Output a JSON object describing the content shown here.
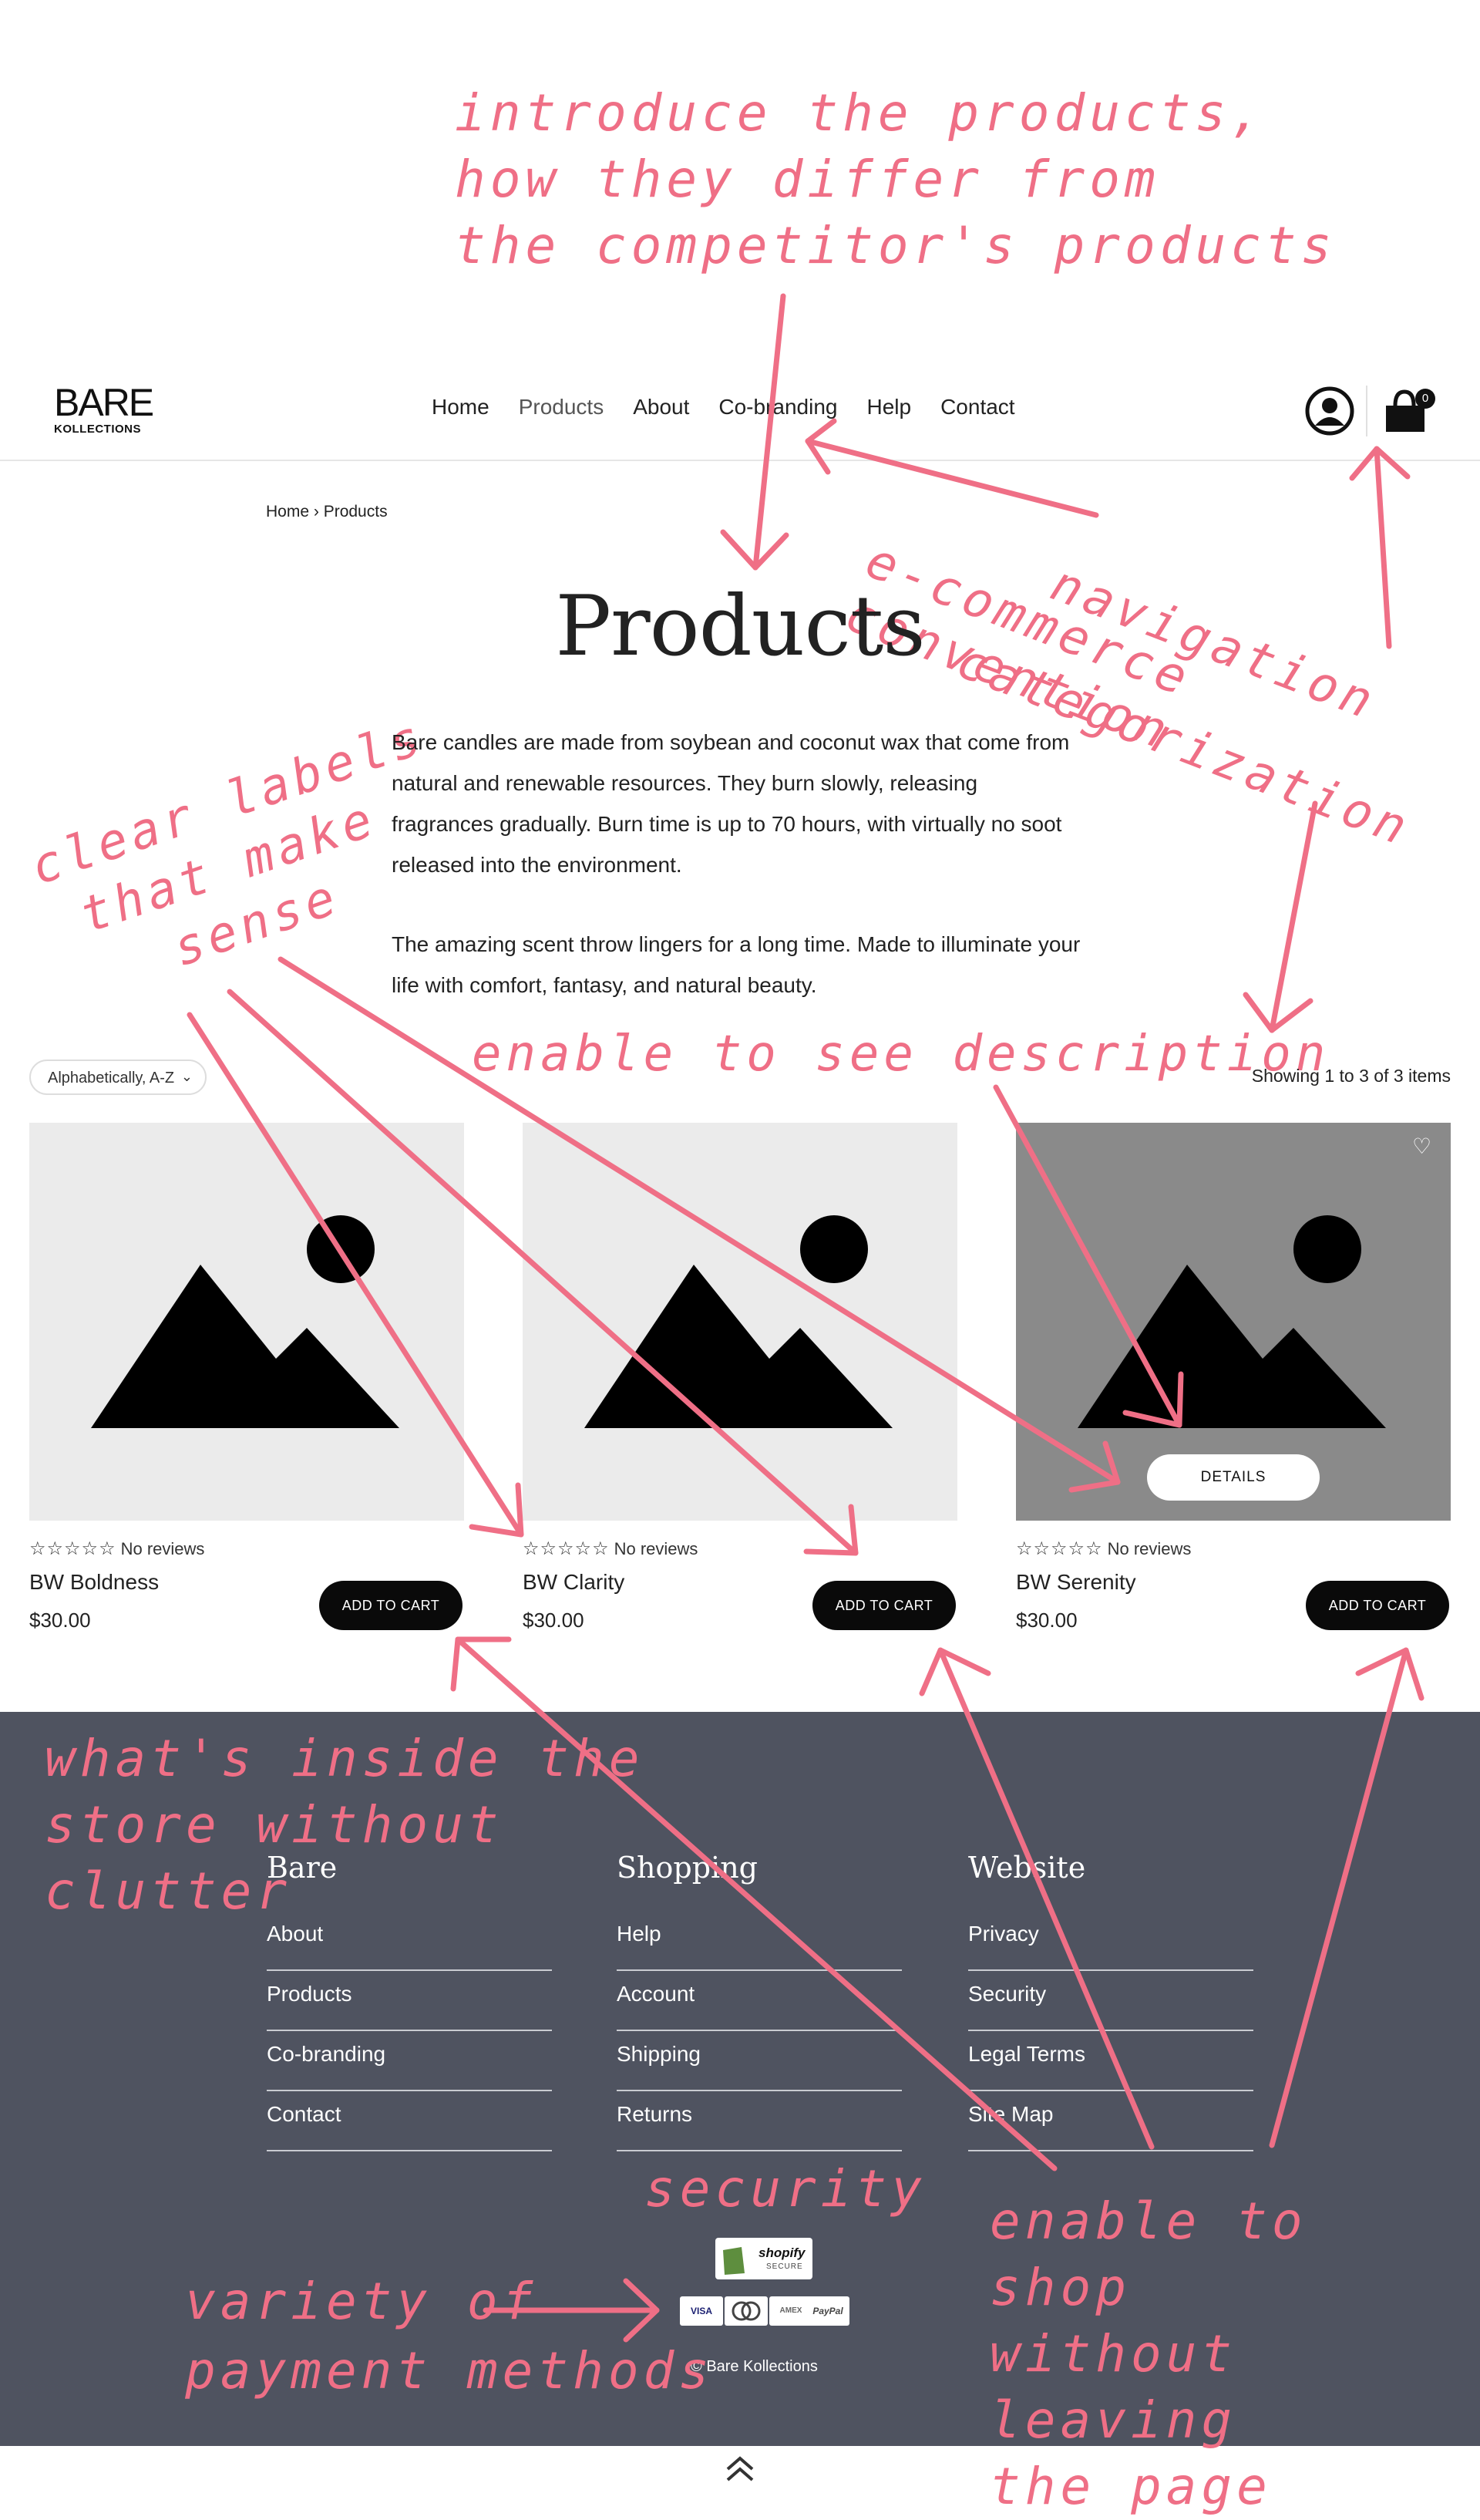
{
  "annotations": {
    "intro": [
      "introduce the products,",
      "how they differ from",
      "the competitor's products"
    ],
    "navigation": "navigation",
    "ecommerce": "e-commerce convention",
    "categorization": "categorization",
    "labels": [
      "clear labels",
      "that make",
      "sense"
    ],
    "see_description": "enable to see description",
    "footer_note": [
      "what's inside the",
      "store without",
      "clutter"
    ],
    "security": "security",
    "payment": [
      "variety of",
      "payment methods"
    ],
    "shop": [
      "enable to shop",
      "without leaving",
      "the page"
    ]
  },
  "header": {
    "logo_top": "BARE",
    "logo_bottom": "KOLLECTIONS",
    "nav": [
      "Home",
      "Products",
      "About",
      "Co-branding",
      "Help",
      "Contact"
    ],
    "cart_count": "0"
  },
  "breadcrumb": {
    "home": "Home",
    "sep": " › ",
    "current": "Products"
  },
  "page_title": "Products",
  "description": {
    "p1": "Bare candles are made from soybean and coconut wax that come from natural and renewable resources. They burn slowly, releasing fragrances gradually. Burn time is up to 70 hours, with virtually no soot released into the environment.",
    "p2": "The amazing scent throw lingers for a long time. Made to illuminate your life with comfort, fantasy, and natural beauty."
  },
  "toolbar": {
    "sort_value": "Alphabetically, A-Z",
    "count": "Showing 1 to 3 of 3 items"
  },
  "products": [
    {
      "name": "BW Boldness",
      "price": "$30.00",
      "reviews": "No reviews",
      "cta": "ADD TO CART",
      "rating": 0
    },
    {
      "name": "BW Clarity",
      "price": "$30.00",
      "reviews": "No reviews",
      "cta": "ADD TO CART",
      "rating": 0
    },
    {
      "name": "BW Serenity",
      "price": "$30.00",
      "reviews": "No reviews",
      "cta": "ADD TO CART",
      "rating": 0,
      "details": "DETAILS"
    }
  ],
  "footer": {
    "columns": [
      {
        "title": "Bare",
        "links": [
          "About",
          "Products",
          "Co-branding",
          "Contact"
        ]
      },
      {
        "title": "Shopping",
        "links": [
          "Help",
          "Account",
          "Shipping",
          "Returns"
        ]
      },
      {
        "title": "Website",
        "links": [
          "Privacy",
          "Security",
          "Legal Terms",
          "Site Map"
        ]
      }
    ],
    "shopify_label": "shopify",
    "shopify_sub": "SECURE",
    "payments": [
      "VISA",
      "MC",
      "AMEX",
      "PayPal"
    ],
    "copyright": "Bare Kollections"
  },
  "colors": {
    "annotation": "#ef6f86",
    "footer_bg": "#4f5360",
    "button": "#0a0a0a"
  }
}
